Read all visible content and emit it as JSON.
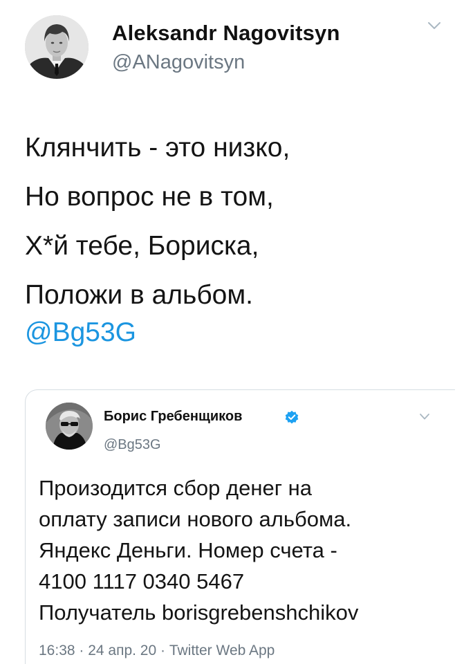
{
  "tweet": {
    "author_name": "Aleksandr Nagovitsyn",
    "author_handle": "@ANagovitsyn",
    "lines": [
      "Клянчить - это низко,",
      "Но вопрос не в том,",
      "Х*й тебе, Бориска,",
      "Положи в альбом."
    ],
    "mention": "@Bg53G"
  },
  "quoted_tweet": {
    "author_name": "Борис Гребенщиков",
    "author_handle": "@Bg53G",
    "verified": true,
    "lines": [
      "Произодится сбор денег на",
      "оплату записи нового альбома.",
      "Яндекс Деньги. Номер счета -",
      "4100 1117 0340 5467",
      "Получатель borisgrebenshchikov"
    ],
    "meta": "16:38 · 24 апр. 20 · Twitter Web App"
  },
  "colors": {
    "link": "#1b95e0",
    "secondary_text": "#6b7782",
    "verified_badge": "#1da1f2",
    "card_border": "#d6dde2"
  },
  "icons": {
    "main_menu": "chevron-down-icon",
    "quote_menu": "chevron-down-icon",
    "verified": "verified-badge-icon"
  }
}
